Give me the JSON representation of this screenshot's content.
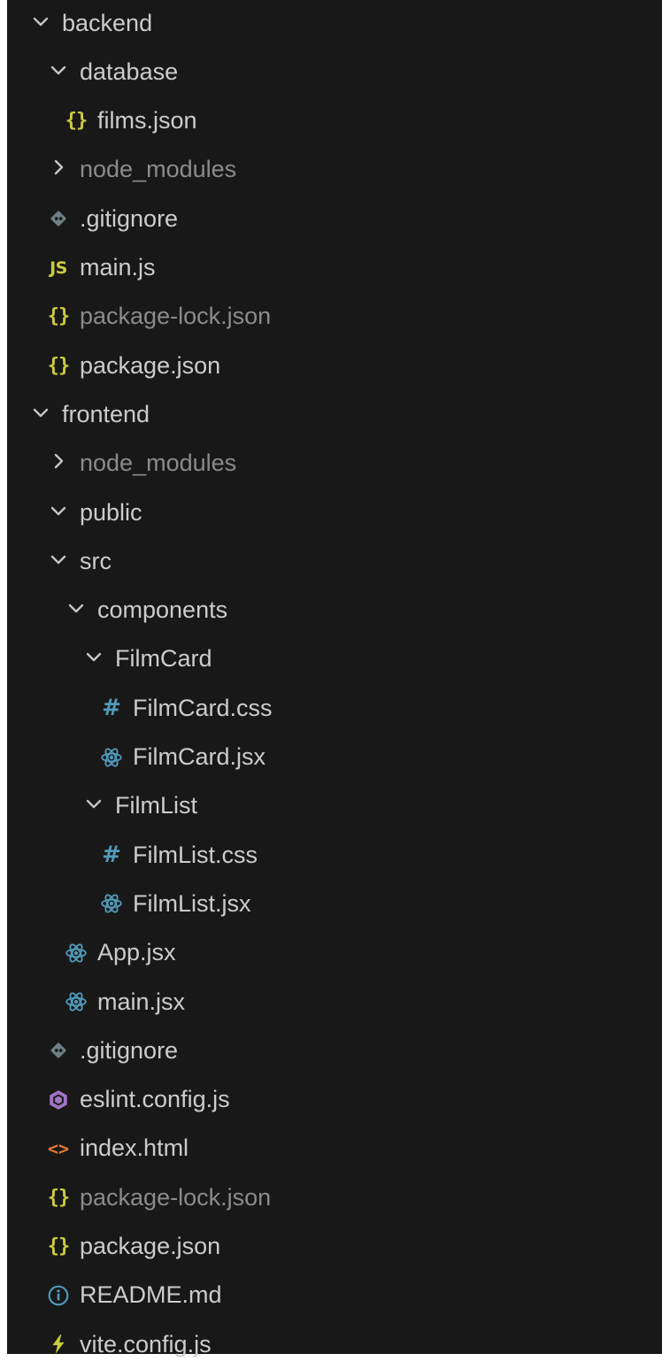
{
  "explorer": {
    "items": [
      {
        "label": "backend",
        "kind": "folder-open",
        "depth": 0
      },
      {
        "label": "database",
        "kind": "folder-open",
        "depth": 1
      },
      {
        "label": "films.json",
        "kind": "json",
        "depth": 2
      },
      {
        "label": "node_modules",
        "kind": "folder-closed",
        "depth": 1,
        "dim": true
      },
      {
        "label": ".gitignore",
        "kind": "git",
        "depth": 1
      },
      {
        "label": "main.js",
        "kind": "js",
        "depth": 1
      },
      {
        "label": "package-lock.json",
        "kind": "json",
        "depth": 1,
        "dim": true
      },
      {
        "label": "package.json",
        "kind": "json",
        "depth": 1
      },
      {
        "label": "frontend",
        "kind": "folder-open",
        "depth": 0
      },
      {
        "label": "node_modules",
        "kind": "folder-closed",
        "depth": 1,
        "dim": true
      },
      {
        "label": "public",
        "kind": "folder-open",
        "depth": 1
      },
      {
        "label": "src",
        "kind": "folder-open",
        "depth": 1
      },
      {
        "label": "components",
        "kind": "folder-open",
        "depth": 2
      },
      {
        "label": "FilmCard",
        "kind": "folder-open",
        "depth": 3
      },
      {
        "label": "FilmCard.css",
        "kind": "css",
        "depth": 4
      },
      {
        "label": "FilmCard.jsx",
        "kind": "react",
        "depth": 4
      },
      {
        "label": "FilmList",
        "kind": "folder-open",
        "depth": 3
      },
      {
        "label": "FilmList.css",
        "kind": "css",
        "depth": 4
      },
      {
        "label": "FilmList.jsx",
        "kind": "react",
        "depth": 4
      },
      {
        "label": "App.jsx",
        "kind": "react",
        "depth": 2
      },
      {
        "label": "main.jsx",
        "kind": "react",
        "depth": 2
      },
      {
        "label": ".gitignore",
        "kind": "git",
        "depth": 1
      },
      {
        "label": "eslint.config.js",
        "kind": "eslint",
        "depth": 1
      },
      {
        "label": "index.html",
        "kind": "html",
        "depth": 1
      },
      {
        "label": "package-lock.json",
        "kind": "json",
        "depth": 1,
        "dim": true
      },
      {
        "label": "package.json",
        "kind": "json",
        "depth": 1
      },
      {
        "label": "README.md",
        "kind": "info",
        "depth": 1
      },
      {
        "label": "vite.config.js",
        "kind": "vite",
        "depth": 1
      }
    ]
  },
  "glyphs": {
    "json": "{}",
    "js": "JS",
    "css": "#",
    "html": "<>"
  },
  "colors": {
    "background": "#181818",
    "text": "#cccccc",
    "dim_text": "#8b8b8b",
    "json": "#cbcb41",
    "js": "#cbcb41",
    "css": "#519aba",
    "react": "#519aba",
    "html": "#e37933",
    "eslint": "#a074c4",
    "info": "#519aba",
    "vite": "#cbcb41",
    "git": "#6d8086"
  }
}
